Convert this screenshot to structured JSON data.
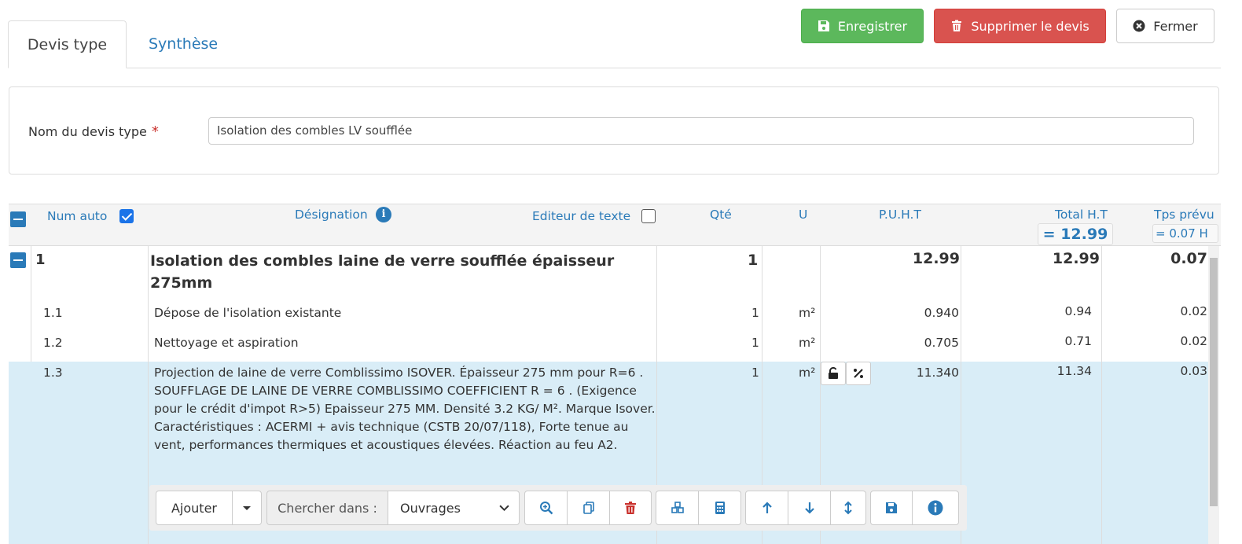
{
  "tabs": [
    {
      "label": "Devis type"
    },
    {
      "label": "Synthèse"
    }
  ],
  "actions": {
    "save": "Enregistrer",
    "delete": "Supprimer le devis",
    "close": "Fermer"
  },
  "form": {
    "name_label": "Nom du devis type",
    "required_mark": "*",
    "name_value": "Isolation des combles LV soufflée"
  },
  "grid": {
    "headers": {
      "num_auto": "Num auto",
      "designation": "Désignation",
      "text_editor": "Editeur de texte",
      "qty": "Qté",
      "unit": "U",
      "puht": "P.U.H.T",
      "total_ht": "Total H.T",
      "time": "Tps prévu"
    },
    "totals": {
      "total_ht": "= 12.99",
      "time": "= 0.07 H"
    },
    "rows": [
      {
        "num": "1",
        "designation": "Isolation des combles laine de verre soufflée épaisseur 275mm",
        "qty": "1",
        "unit": "",
        "puht": "12.99",
        "total": "12.99",
        "time": "0.07"
      },
      {
        "num": "1.1",
        "designation": "Dépose de l'isolation existante",
        "qty": "1",
        "unit": "m²",
        "puht": "0.940",
        "total": "0.94",
        "time": "0.02"
      },
      {
        "num": "1.2",
        "designation": "Nettoyage et aspiration",
        "qty": "1",
        "unit": "m²",
        "puht": "0.705",
        "total": "0.71",
        "time": "0.02"
      },
      {
        "num": "1.3",
        "designation": "Projection de laine de verre Comblissimo ISOVER. Épaisseur 275 mm pour R=6 . SOUFFLAGE DE LAINE DE VERRE COMBLISSIMO COEFFICIENT R = 6 . (Exigence pour le crédit d'impot R>5) Epaisseur 275 MM. Densité 3.2 KG/ M². Marque Isover. Caractéristiques : ACERMI + avis technique (CSTB 20/07/118), Forte tenue au vent, performances thermiques et acoustiques élevées. Réaction au feu A2.",
        "qty": "1",
        "unit": "m²",
        "puht": "11.340",
        "total": "11.34",
        "time": "0.03"
      }
    ]
  },
  "toolbar": {
    "add": "Ajouter",
    "search_in": "Chercher dans :",
    "search_select": "Ouvrages"
  },
  "colors": {
    "primary": "#2a7ab8",
    "success": "#5cb85c",
    "danger": "#d9534f",
    "selected_row": "#d9edf7"
  }
}
